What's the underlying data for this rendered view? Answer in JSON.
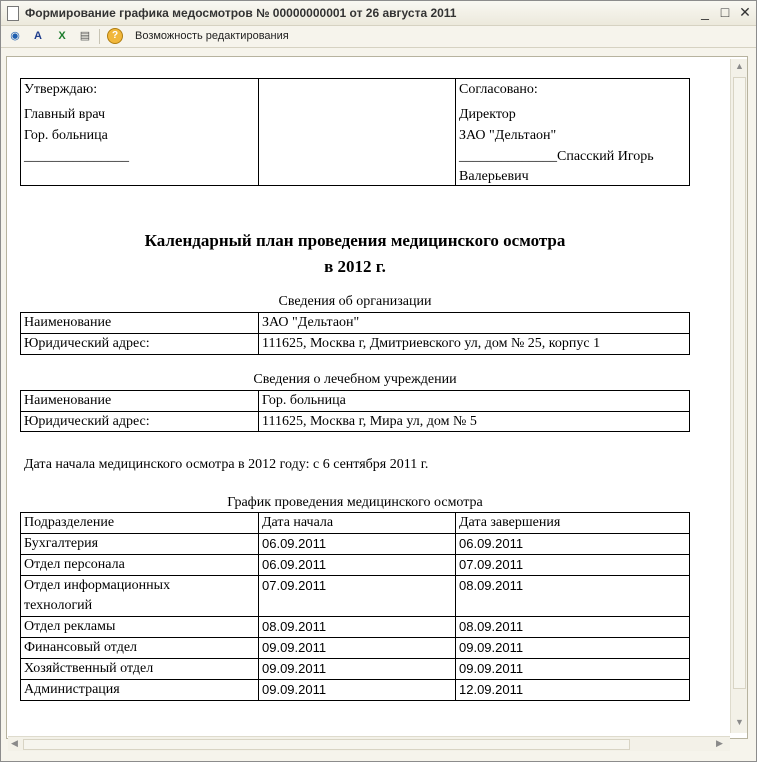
{
  "window": {
    "title": "Формирование графика медосмотров № 00000000001 от 26 августа 2011",
    "minimize": "_",
    "maximize": "□",
    "close": "✕"
  },
  "toolbar": {
    "edit_label": "Возможность редактирования",
    "help": "?"
  },
  "approval": {
    "left_title": "Утверждаю:",
    "left_position": "Главный врач",
    "left_org": "Гор. больница",
    "left_sign": "_______________",
    "right_title": "Согласовано:",
    "right_position": "Директор",
    "right_org": "ЗАО \"Дельтаон\"",
    "right_sign": "______________Спасский Игорь",
    "right_sign_cont": "Валерьевич"
  },
  "heading": {
    "line1": "Календарный план проведения медицинского осмотра",
    "line2": "в 2012 г."
  },
  "org": {
    "caption": "Сведения об организации",
    "rows": [
      {
        "label": "Наименование",
        "value": "ЗАО \"Дельтаон\""
      },
      {
        "label": "Юридический адрес:",
        "value": "111625, Москва г, Дмитриевского ул, дом № 25, корпус 1"
      }
    ]
  },
  "clinic": {
    "caption": "Сведения о лечебном учреждении",
    "rows": [
      {
        "label": "Наименование",
        "value": "Гор. больница"
      },
      {
        "label": "Юридический адрес:",
        "value": "111625, Москва г, Мира ул, дом № 5"
      }
    ]
  },
  "start_date_text": "Дата начала медицинского осмотра в 2012 году: с 6 сентября 2011 г.",
  "schedule": {
    "caption": "График проведения медицинского осмотра",
    "headers": [
      "Подразделение",
      "Дата начала",
      "Дата завершения"
    ],
    "rows": [
      {
        "dept": "Бухгалтерия",
        "dept2": "",
        "start": "06.09.2011",
        "end": "06.09.2011"
      },
      {
        "dept": "Отдел персонала",
        "dept2": "",
        "start": "06.09.2011",
        "end": "07.09.2011"
      },
      {
        "dept": "Отдел информационных",
        "dept2": "технологий",
        "start": "07.09.2011",
        "end": "08.09.2011"
      },
      {
        "dept": "Отдел рекламы",
        "dept2": "",
        "start": "08.09.2011",
        "end": "08.09.2011"
      },
      {
        "dept": "Финансовый отдел",
        "dept2": "",
        "start": "09.09.2011",
        "end": "09.09.2011"
      },
      {
        "dept": "Хозяйственный отдел",
        "dept2": "",
        "start": "09.09.2011",
        "end": "09.09.2011"
      },
      {
        "dept": "Администрация",
        "dept2": "",
        "start": "09.09.2011",
        "end": "12.09.2011"
      }
    ]
  }
}
